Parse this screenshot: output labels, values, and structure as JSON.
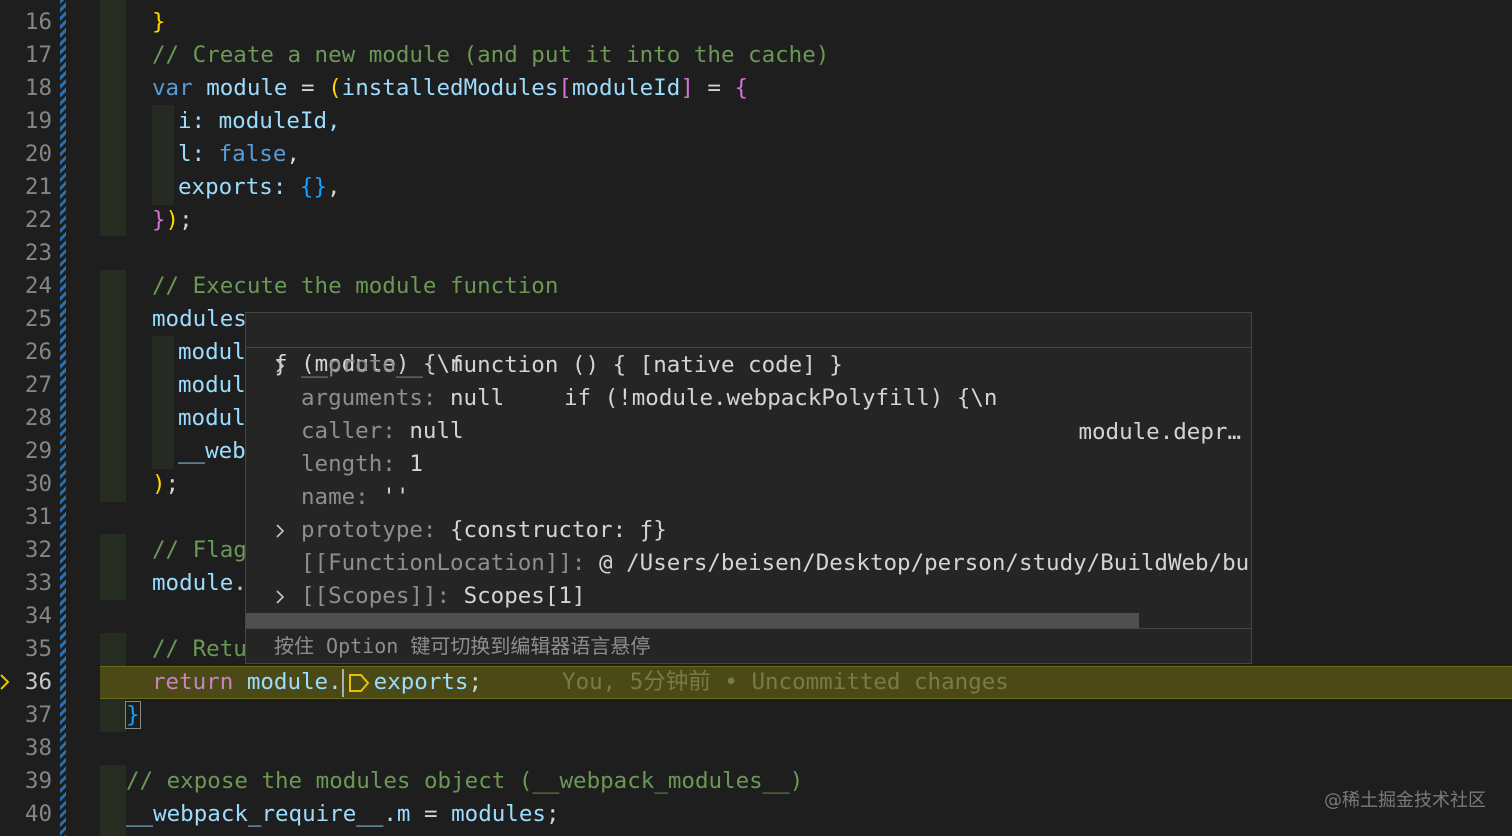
{
  "editor": {
    "line_numbers": [
      "16",
      "17",
      "18",
      "19",
      "20",
      "21",
      "22",
      "23",
      "24",
      "25",
      "26",
      "27",
      "28",
      "29",
      "30",
      "31",
      "32",
      "33",
      "34",
      "35",
      "36",
      "37",
      "38",
      "39",
      "40"
    ],
    "current_line": "36",
    "code": {
      "l16_close": "}",
      "l17_comment": "// Create a new module (and put it into the cache)",
      "l18_var": "var",
      "l18_module": "module",
      "l18_eq": " = ",
      "l18_paren": "(",
      "l18_installed": "installedModules",
      "l18_lbr": "[",
      "l18_moduleId": "moduleId",
      "l18_rbr": "]",
      "l18_eq2": " = ",
      "l18_brace": "{",
      "l19": "i: moduleId,",
      "l20_key": "l: ",
      "l20_val": "false",
      "l20_comma": ",",
      "l21_key": "exports: ",
      "l21_val": "{}",
      "l21_comma": ",",
      "l22_brace": "}",
      "l22_paren": ")",
      "l22_semi": ";",
      "l24_comment": "// Execute the module function",
      "l25": "modules",
      "l26": "modul",
      "l27": "modul",
      "l28": "modul",
      "l29": "__web",
      "l30_paren": ")",
      "l30_semi": ";",
      "l32_comment": "// Flag",
      "l33": "module.",
      "l35_comment": "// Retu",
      "l36_return": "return",
      "l36_module": " module.",
      "l36_exports": "exports",
      "l36_semi": ";",
      "l36_blame": "You, 5分钟前 • Uncommitted changes",
      "l37_close": "}",
      "l39_comment": "// expose the modules object (__webpack_modules__)",
      "l40_require": "__webpack_require__",
      "l40_m": ".m",
      "l40_eq": " = ",
      "l40_modules": "modules",
      "l40_semi": ";"
    }
  },
  "hover": {
    "header_a": "ƒ (module) {\\n",
    "header_b": "if (!module.webpackPolyfill) {\\n",
    "header_c": "module.depr…",
    "properties": [
      {
        "key": "__proto__: ",
        "value": "function () { [native code] }",
        "expandable": true
      },
      {
        "key": "arguments: ",
        "value": "null",
        "expandable": false
      },
      {
        "key": "caller: ",
        "value": "null",
        "expandable": false
      },
      {
        "key": "length: ",
        "value": "1",
        "expandable": false
      },
      {
        "key": "name: ",
        "value": "''",
        "expandable": false
      },
      {
        "key": "prototype: ",
        "value": "{constructor: ƒ}",
        "expandable": true
      },
      {
        "key": "[[FunctionLocation]]: ",
        "value": "@ /Users/beisen/Desktop/person/study/BuildWeb/build/build",
        "expandable": false
      },
      {
        "key": "[[Scopes]]: ",
        "value": "Scopes[1]",
        "expandable": true
      }
    ],
    "footer": "按住 Option 键可切换到编辑器语言悬停"
  },
  "watermark": "@稀土掘金技术社区",
  "icons": {
    "chevron": "chevron-right-icon",
    "breakpoint": "debug-arrow-icon"
  }
}
